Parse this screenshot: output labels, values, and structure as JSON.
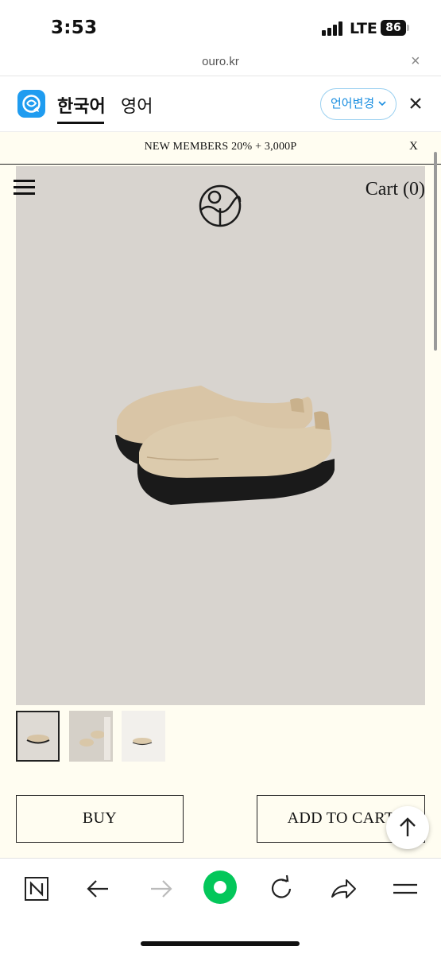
{
  "status_bar": {
    "time": "3:53",
    "network": "LTE",
    "battery": "86",
    "icons": [
      "signal-icon",
      "battery-icon"
    ]
  },
  "browser": {
    "url": "ouro.kr",
    "close_icon": "close-icon"
  },
  "translate_bar": {
    "app_icon": "papago-icon",
    "source_lang": "한국어",
    "target_lang": "영어",
    "change_label": "언어변경",
    "accent_color": "#1a8ee0"
  },
  "site": {
    "promo_text": "NEW MEMBERS 20% + 3,000P",
    "promo_close": "X",
    "cart_label": "Cart (0)",
    "menu_icon": "hamburger-icon",
    "logo_icon": "ouro-logo-icon",
    "background_color": "#fffdf1",
    "thumbnails": [
      {
        "name": "thumb-1",
        "selected": true
      },
      {
        "name": "thumb-2",
        "selected": false
      },
      {
        "name": "thumb-3",
        "selected": false
      }
    ],
    "buy_label": "BUY",
    "add_to_cart_label": "ADD TO CART"
  },
  "toolbar": {
    "icons": [
      "naver-icon",
      "back-arrow-icon",
      "forward-arrow-icon",
      "green-home-icon",
      "refresh-icon",
      "share-icon",
      "menu-icon"
    ]
  }
}
